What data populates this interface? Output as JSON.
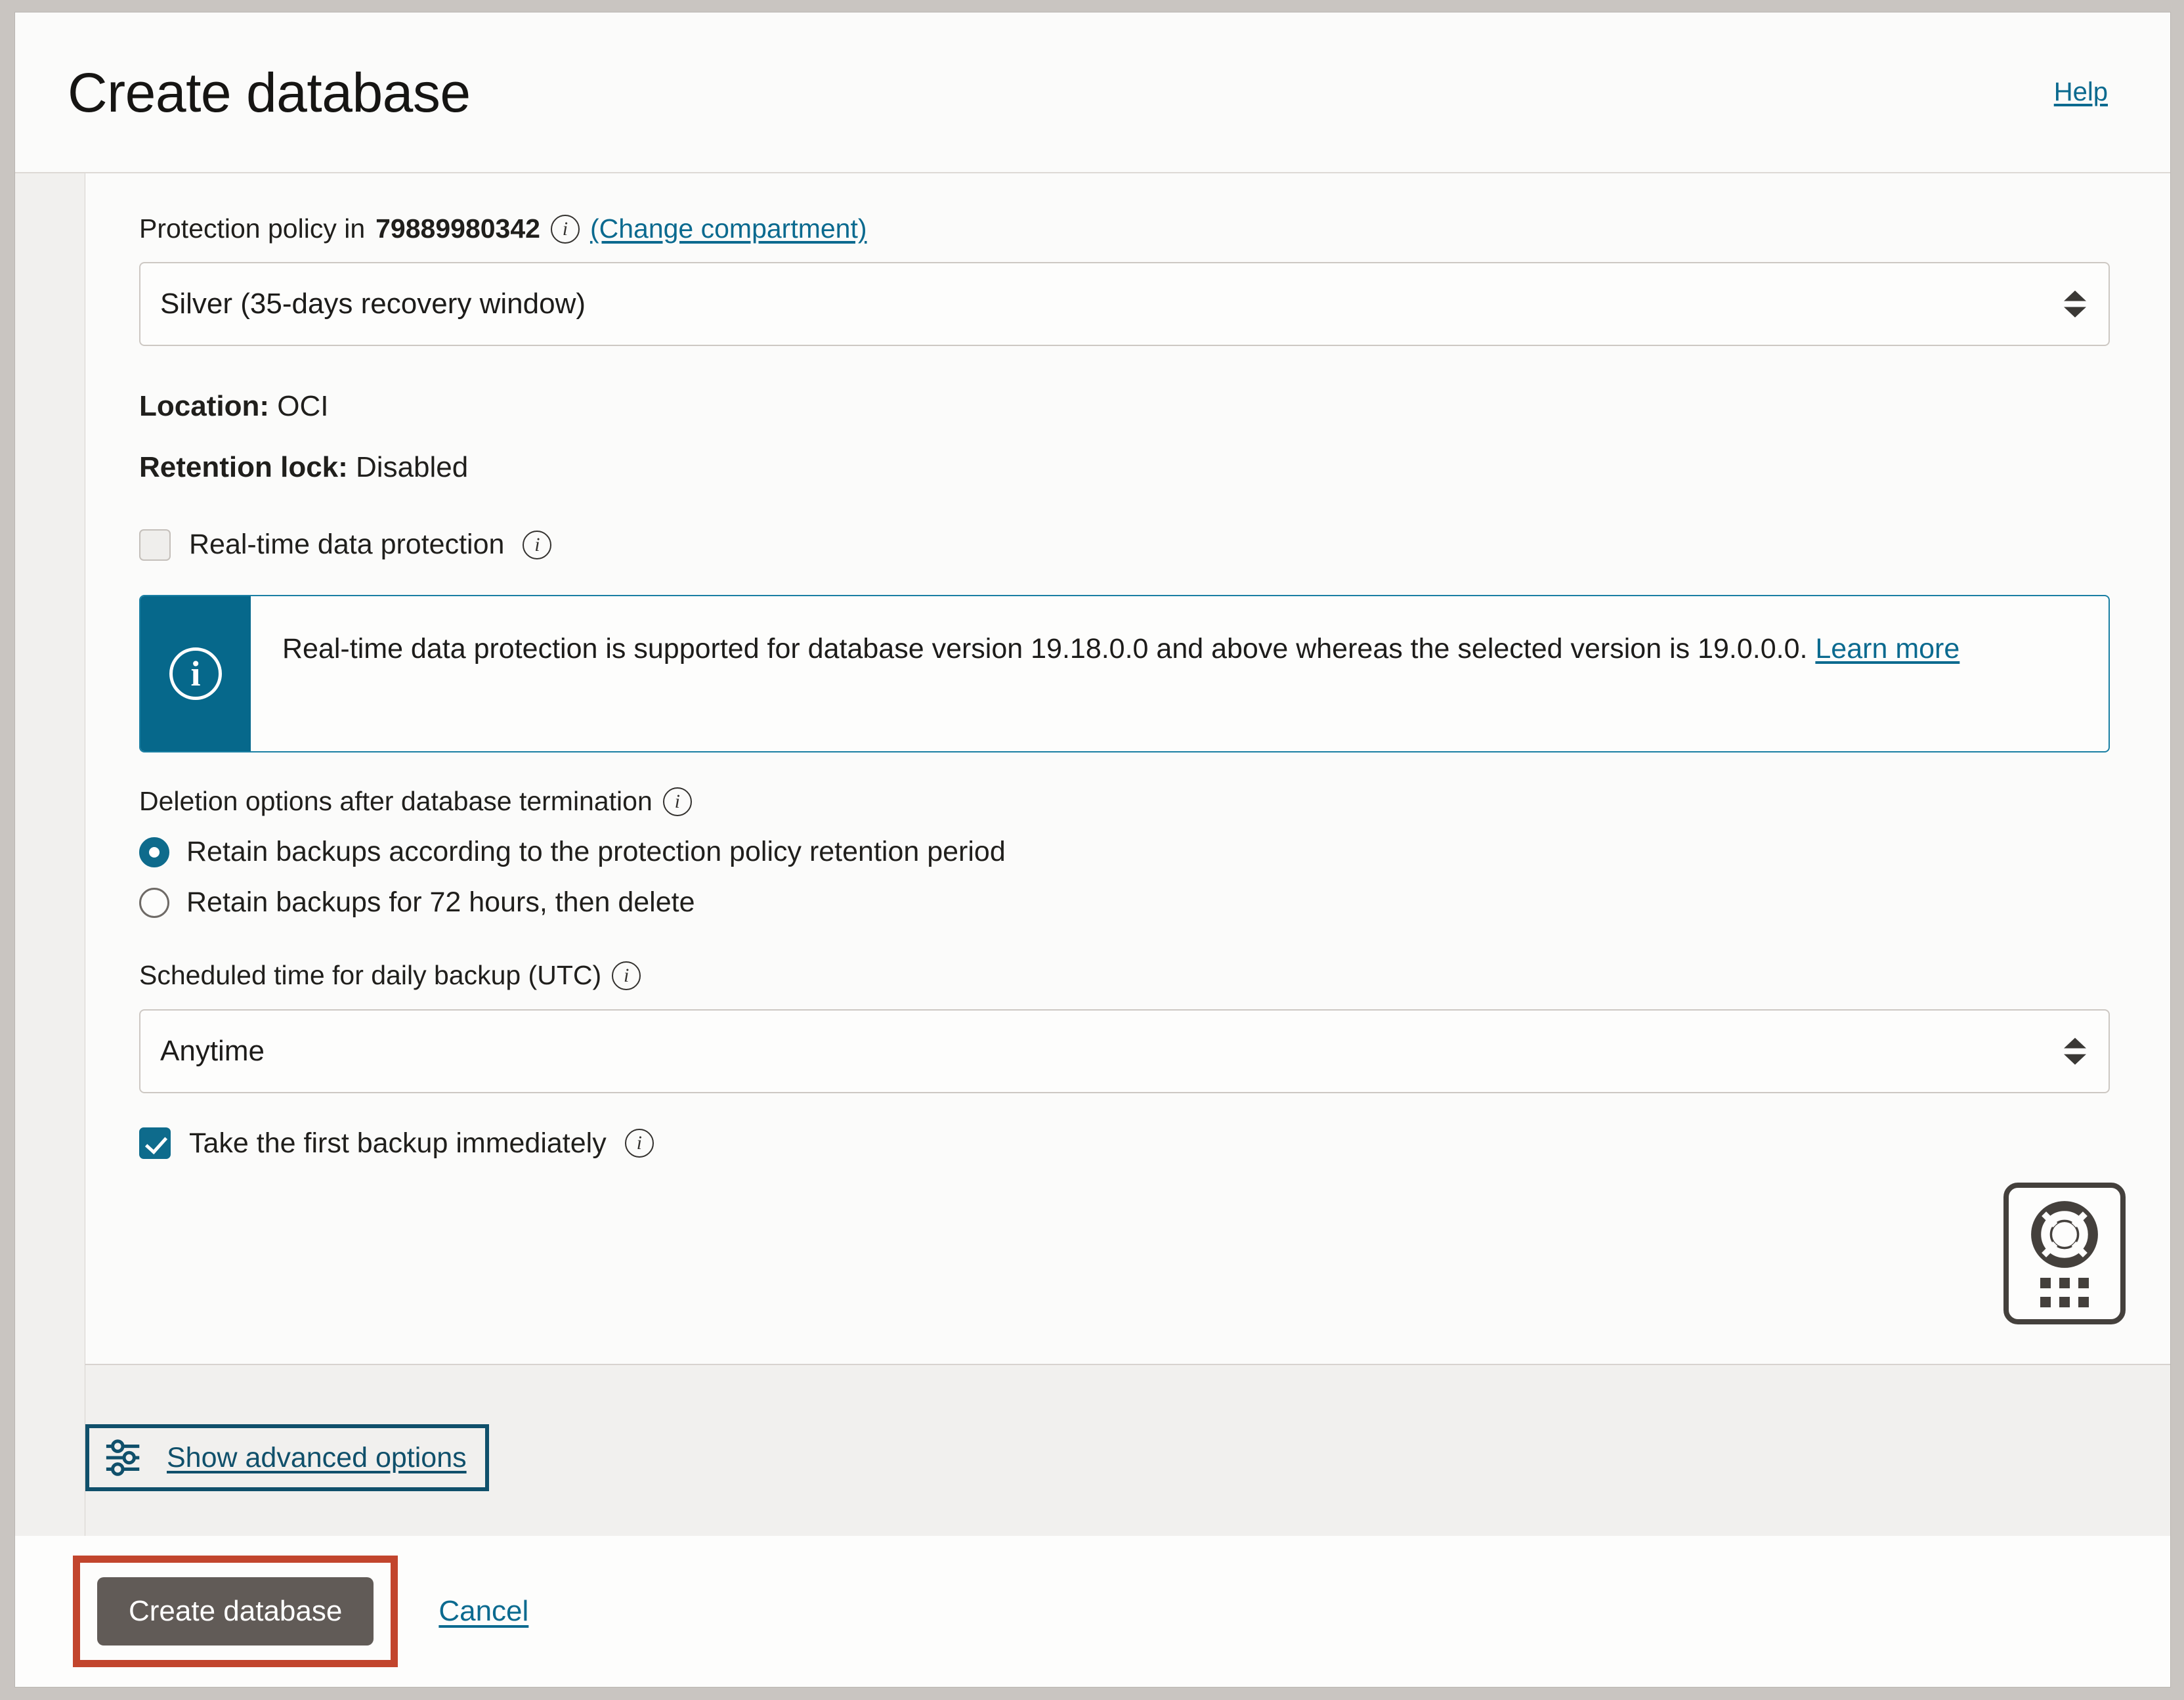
{
  "header": {
    "title": "Create database",
    "help_label": "Help"
  },
  "form": {
    "protection_policy": {
      "label_prefix": "Protection policy in",
      "compartment": "79889980342",
      "info_icon": "info-icon",
      "change_compartment_link": "(Change compartment)",
      "selected_value": "Silver (35-days recovery window)"
    },
    "location": {
      "label": "Location:",
      "value": "OCI"
    },
    "retention_lock": {
      "label": "Retention lock:",
      "value": "Disabled"
    },
    "realtime_protection": {
      "label": "Real-time data protection",
      "checked": false,
      "info_icon": "info-icon"
    },
    "banner": {
      "icon": "info-circle-icon",
      "text": "Real-time data protection is supported for database version 19.18.0.0 and above whereas the selected version is 19.0.0.0.",
      "link_label": "Learn more"
    },
    "deletion_options": {
      "label": "Deletion options after database termination",
      "info_icon": "info-icon",
      "options": [
        {
          "label": "Retain backups according to the protection policy retention period",
          "selected": true
        },
        {
          "label": "Retain backups for 72 hours, then delete",
          "selected": false
        }
      ]
    },
    "scheduled_time": {
      "label": "Scheduled time for daily backup (UTC)",
      "info_icon": "info-icon",
      "selected_value": "Anytime"
    },
    "first_backup": {
      "label": "Take the first backup immediately",
      "checked": true,
      "info_icon": "info-icon"
    },
    "advanced_options": {
      "icon": "sliders-icon",
      "label": "Show advanced options"
    }
  },
  "help_widget": {
    "icon": "life-ring-icon",
    "handle": "drag-handle-dots"
  },
  "footer": {
    "create_button_label": "Create database",
    "cancel_label": "Cancel"
  },
  "colors": {
    "accent": "#0b6a8f",
    "banner_icon_bg": "#06688b",
    "annotation_red": "#c2452d",
    "annotation_blue": "#10506b",
    "primary_button_bg": "#615b57"
  }
}
